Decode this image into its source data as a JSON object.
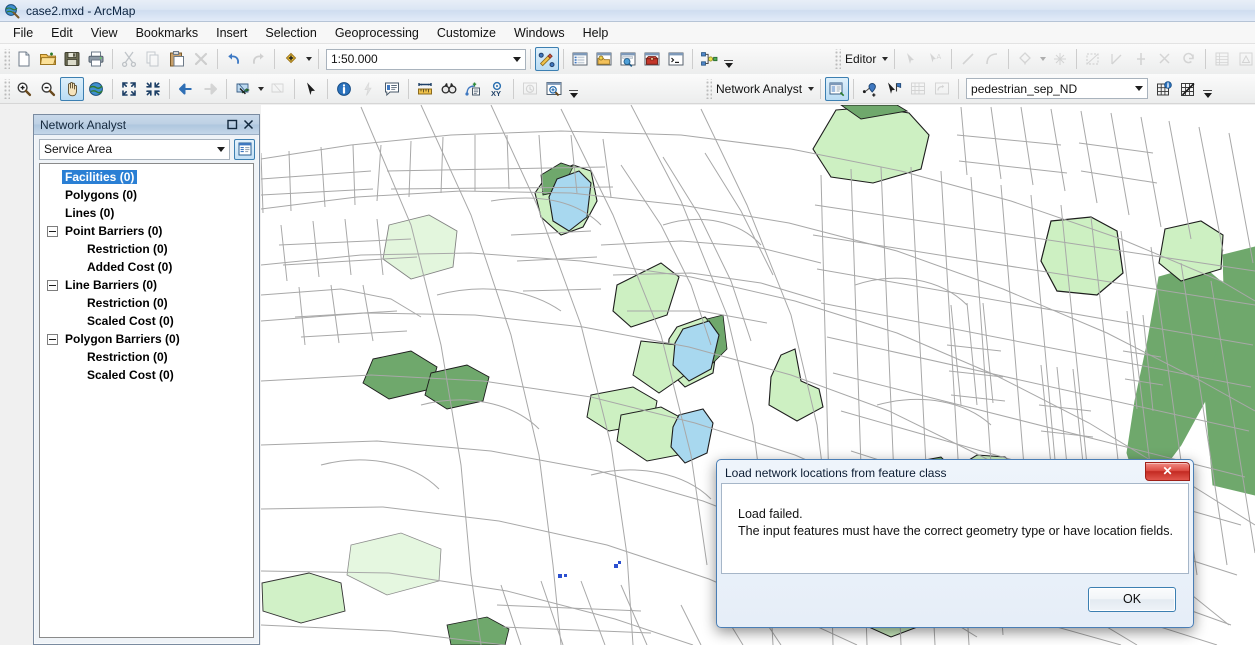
{
  "window": {
    "title": "case2.mxd - ArcMap",
    "app_icon": "arcmap-globe-icon"
  },
  "menubar": {
    "items": [
      {
        "label": "File",
        "name": "menu-file"
      },
      {
        "label": "Edit",
        "name": "menu-edit"
      },
      {
        "label": "View",
        "name": "menu-view"
      },
      {
        "label": "Bookmarks",
        "name": "menu-bookmarks"
      },
      {
        "label": "Insert",
        "name": "menu-insert"
      },
      {
        "label": "Selection",
        "name": "menu-selection"
      },
      {
        "label": "Geoprocessing",
        "name": "menu-geoprocessing"
      },
      {
        "label": "Customize",
        "name": "menu-customize"
      },
      {
        "label": "Windows",
        "name": "menu-windows"
      },
      {
        "label": "Help",
        "name": "menu-help"
      }
    ]
  },
  "standard_toolbar": {
    "scale": {
      "value": "1:50.000",
      "placeholder": "1:50.000"
    },
    "buttons": [
      "new-document-icon",
      "open-document-icon",
      "save-icon",
      "print-icon",
      "cut-icon",
      "copy-icon",
      "paste-icon",
      "delete-icon",
      "undo-icon",
      "redo-icon",
      "add-data-icon",
      "editor-toolbar-toggle-icon",
      "table-of-contents-icon",
      "catalog-window-icon",
      "search-window-icon",
      "arctoolbox-icon",
      "python-window-icon",
      "modelbuilder-icon"
    ]
  },
  "tools_toolbar": {
    "buttons": [
      "zoom-in-icon",
      "zoom-out-icon",
      "pan-icon",
      "full-extent-icon",
      "fixed-zoom-in-icon",
      "fixed-zoom-out-icon",
      "go-back-extent-icon",
      "go-forward-extent-icon",
      "select-features-icon",
      "clear-selection-icon",
      "select-elements-icon",
      "identify-icon",
      "hyperlink-icon",
      "html-popup-icon",
      "measure-icon",
      "find-icon",
      "find-route-icon",
      "go-to-xy-icon",
      "time-slider-icon",
      "create-viewer-window-icon"
    ],
    "active_tool": "pan-icon"
  },
  "editor_toolbar": {
    "label": "Editor",
    "buttons": [
      "edit-tool-icon",
      "edit-annotation-icon",
      "straight-segment-icon",
      "arc-segment-icon",
      "construction-tool-icon",
      "midpoint-icon",
      "trace-icon",
      "right-angle-icon",
      "split-tool-icon",
      "rotate-icon",
      "undo-edit-icon",
      "attributes-icon",
      "sketch-properties-icon",
      "create-features-icon"
    ]
  },
  "advanced_editing_toolbar": {
    "buttons": [
      "replace-geometry-icon",
      "explode-multipart-icon",
      "construct-points-icon",
      "topology-edit-icon",
      "validate-features-icon",
      "reshape-icon"
    ]
  },
  "network_analyst_toolbar": {
    "label": "Network Analyst",
    "dataset": {
      "value": "pedestrian_sep_ND",
      "placeholder": "pedestrian_sep_ND"
    },
    "buttons": [
      "network-analyst-window-icon",
      "create-network-location-icon",
      "select-network-location-icon",
      "build-service-area-icon",
      "directions-window-icon",
      "network-identify-icon",
      "network-disabled-icon"
    ],
    "active_button": "network-analyst-window-icon"
  },
  "network_analyst_panel": {
    "title": "Network Analyst",
    "maximize_icon": "maximize-icon",
    "close_icon": "close-icon",
    "analysis_layer": {
      "value": "Service Area",
      "placeholder": "Service Area"
    },
    "window_button_icon": "network-analyst-window-toggle-icon",
    "tree": [
      {
        "label": "Facilities (0)",
        "indent": 1,
        "expander": false,
        "selected": true,
        "name": "tree-item-facilities"
      },
      {
        "label": "Polygons (0)",
        "indent": 1,
        "expander": false,
        "selected": false,
        "name": "tree-item-polygons"
      },
      {
        "label": "Lines (0)",
        "indent": 1,
        "expander": false,
        "selected": false,
        "name": "tree-item-lines"
      },
      {
        "label": "Point Barriers (0)",
        "indent": 0,
        "expander": true,
        "selected": false,
        "name": "tree-item-point-barriers"
      },
      {
        "label": "Restriction (0)",
        "indent": 2,
        "expander": false,
        "selected": false,
        "name": "tree-item-point-restriction"
      },
      {
        "label": "Added Cost (0)",
        "indent": 2,
        "expander": false,
        "selected": false,
        "name": "tree-item-point-added-cost"
      },
      {
        "label": "Line Barriers (0)",
        "indent": 0,
        "expander": true,
        "selected": false,
        "name": "tree-item-line-barriers"
      },
      {
        "label": "Restriction (0)",
        "indent": 2,
        "expander": false,
        "selected": false,
        "name": "tree-item-line-restriction"
      },
      {
        "label": "Scaled Cost (0)",
        "indent": 2,
        "expander": false,
        "selected": false,
        "name": "tree-item-line-scaled-cost"
      },
      {
        "label": "Polygon Barriers (0)",
        "indent": 0,
        "expander": true,
        "selected": false,
        "name": "tree-item-polygon-barriers"
      },
      {
        "label": "Restriction (0)",
        "indent": 2,
        "expander": false,
        "selected": false,
        "name": "tree-item-polygon-restriction"
      },
      {
        "label": "Scaled Cost (0)",
        "indent": 2,
        "expander": false,
        "selected": false,
        "name": "tree-item-polygon-scaled-cost"
      }
    ]
  },
  "dialog": {
    "title": "Load network locations from feature class",
    "close_label": "✕",
    "message_line1": "Load failed.",
    "message_line2": "The input features must have the correct geometry type or have location fields.",
    "ok_label": "OK"
  },
  "map": {
    "colors": {
      "background": "#ffffff",
      "road": "#a8a8a8",
      "road_minor": "#bcbcbc",
      "water": "#a8d8ef",
      "park_light": "#cdf0c2",
      "park_dark": "#6fa86c",
      "outline": "#1d1d1d",
      "point_marker": "#2b4fd0"
    }
  }
}
